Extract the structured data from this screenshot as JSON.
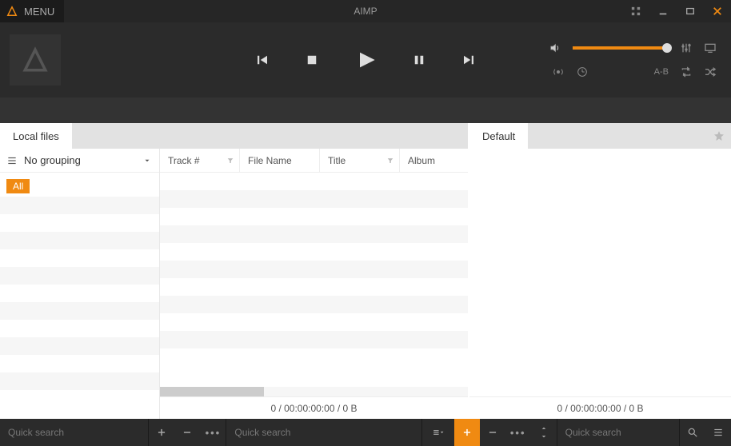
{
  "titlebar": {
    "menu_label": "MENU",
    "app_title": "AIMP"
  },
  "sidebar": {
    "grouping_label": "No grouping",
    "filter_all": "All"
  },
  "tabs": {
    "left": "Local files",
    "right": "Default"
  },
  "columns": {
    "track": "Track #",
    "filename": "File Name",
    "title": "Title",
    "album": "Album"
  },
  "footer": {
    "left_status": "0 / 00:00:00:00 / 0 B",
    "right_status": "0 / 00:00:00:00 / 0 B"
  },
  "search": {
    "placeholder": "Quick search"
  },
  "labels": {
    "ab": "A-B"
  }
}
